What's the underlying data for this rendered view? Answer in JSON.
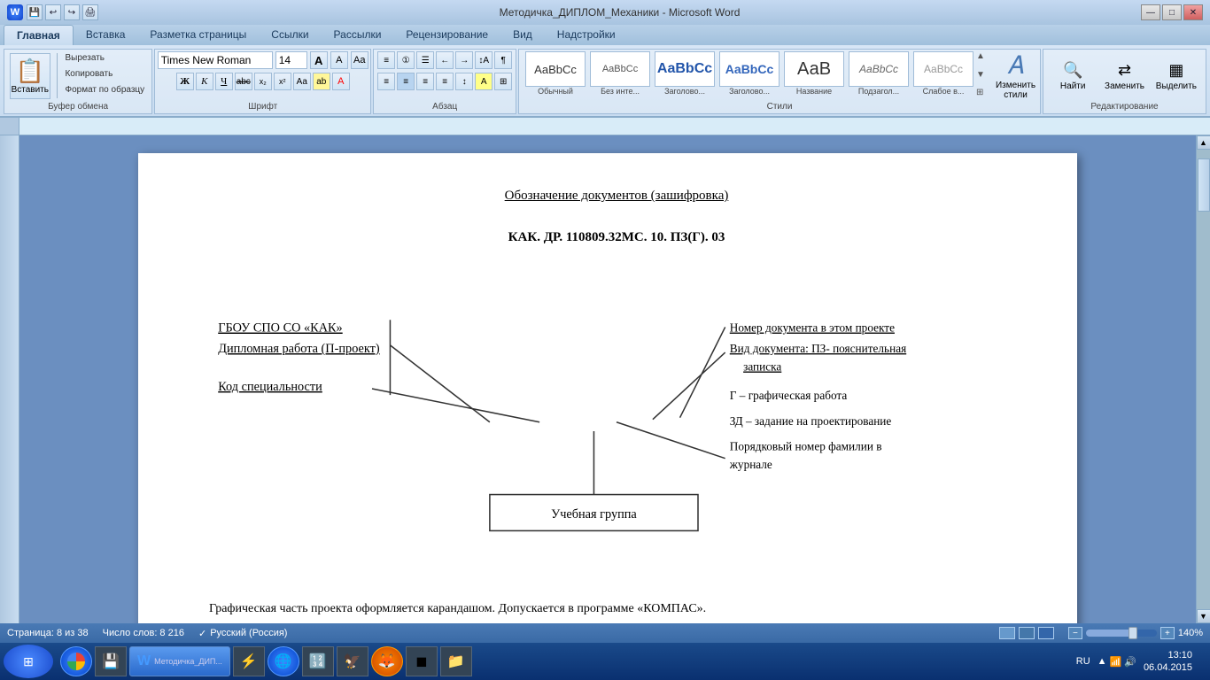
{
  "window": {
    "title": "Методичка_ДИПЛОМ_Механики - Microsoft Word",
    "min_btn": "—",
    "max_btn": "□",
    "close_btn": "✕"
  },
  "ribbon": {
    "tabs": [
      "Главная",
      "Вставка",
      "Разметка страницы",
      "Ссылки",
      "Рассылки",
      "Рецензирование",
      "Вид",
      "Надстройки"
    ],
    "active_tab": "Главная",
    "clipboard": {
      "paste": "Вставить",
      "cut": "Вырезать",
      "copy": "Копировать",
      "format_painter": "Формат по образцу",
      "group_label": "Буфер обмена"
    },
    "font": {
      "font_name": "Times New Roman",
      "font_size": "14",
      "grow": "A",
      "shrink": "a",
      "clear": "Aa",
      "bold": "Ж",
      "italic": "К",
      "underline": "Ч",
      "strikethrough": "abc",
      "subscript": "x₂",
      "superscript": "x²",
      "case": "Аа",
      "highlight": "ab",
      "color": "А",
      "group_label": "Шрифт"
    },
    "paragraph": {
      "group_label": "Абзац"
    },
    "styles": {
      "items": [
        {
          "label": "Обычный",
          "style": "normal"
        },
        {
          "label": "Без инте...",
          "style": "nobounds"
        },
        {
          "label": "Заголово...",
          "style": "h1"
        },
        {
          "label": "Заголово...",
          "style": "h2"
        },
        {
          "label": "Название",
          "style": "title"
        },
        {
          "label": "Подзагол...",
          "style": "subtitle"
        },
        {
          "label": "Слабое в...",
          "style": "weak"
        }
      ],
      "group_label": "Стили",
      "change_label": "Изменить\nстили"
    },
    "editing": {
      "find": "Найти",
      "replace": "Заменить",
      "select": "Выделить",
      "group_label": "Редактирование"
    }
  },
  "document": {
    "title": "Обозначение документов (зашифровка)",
    "code": "КАК. ДР. 110809.32МС. 10. ПЗ(Г). 03",
    "labels": {
      "left1": "ГБОУ СПО СО «КАК»",
      "left2": "Дипломная работа (П-проект)",
      "left3": "Код специальности",
      "right1": "Номер документа в этом проекте",
      "right2": "Вид документа: ПЗ- пояснительная записка",
      "right3": "Г – графическая работа",
      "right4": "ЗД – задание на проектирование",
      "right5": "Порядковый номер фамилии в журнале",
      "box": "Учебная группа"
    },
    "bottom_text": "Графическая часть проекта оформляется карандашом. Допускается в программе «КОМПАС»."
  },
  "status_bar": {
    "page": "Страница: 8 из 38",
    "words": "Число слов: 8 216",
    "language": "Русский (Россия)",
    "zoom": "140%"
  },
  "taskbar": {
    "time": "13:10",
    "date": "06.04.2015",
    "language": "RU"
  }
}
